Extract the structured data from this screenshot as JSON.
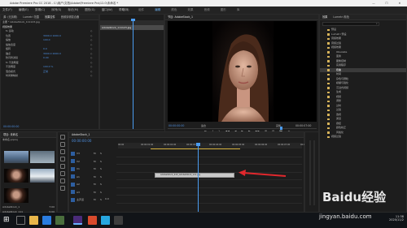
{
  "titlebar": {
    "title": "Adobe Premiere Pro CC 2018 - C:\\用户\\文档\\Adobe\\Premiere Pro\\12.0\\未命名 *",
    "minimize": "—",
    "maximize": "☐",
    "close": "✕"
  },
  "menubar": {
    "items": [
      "文件(F)",
      "编辑(E)",
      "剪辑(C)",
      "序列(S)",
      "标记(M)",
      "图形(G)",
      "窗口(W)",
      "帮助(H)"
    ]
  },
  "workspaces": {
    "items": [
      "学习",
      "组件",
      "编辑",
      "颜色",
      "效果",
      "音频",
      "图形",
      "库"
    ],
    "active": "编辑"
  },
  "effect_controls": {
    "tabs": [
      "源: (无剪辑)",
      "Lumetri 范围",
      "效果控件",
      "音频剪辑混合器"
    ],
    "active_tab": "效果控件",
    "clip_label": "主要 * AdobeStock_111123.jpg",
    "sequence_label": "AdobeStock_1 * AdobeStock_111123.jpg",
    "section": "视频效果",
    "rows": [
      {
        "name": "fx 运动",
        "value": ""
      },
      {
        "name": "位置",
        "value": "3000.0   1000.0"
      },
      {
        "name": "缩放",
        "value": "100.0"
      },
      {
        "name": "缩放宽度",
        "value": ""
      },
      {
        "name": "旋转",
        "value": "0.0"
      },
      {
        "name": "锚点",
        "value": "3000.0   2000.0"
      },
      {
        "name": "防闪烁滤镜",
        "value": "0.00"
      },
      {
        "name": "fx 不透明度",
        "value": ""
      },
      {
        "name": "不透明度",
        "value": "100.0 %"
      },
      {
        "name": "混合模式",
        "value": "正常"
      },
      {
        "name": "时间重映射",
        "value": ""
      }
    ],
    "timecode": "00:00:00:00"
  },
  "fx_timeline": {
    "clip_label": "AdobeStock_111123.jpg",
    "timecode": "00:00:05:00"
  },
  "program": {
    "tab": "节目: AdobeStock_1",
    "timecode_left": "00:00:00:00",
    "fit": "适合",
    "quality": "完整",
    "timecode_right": "00:00:07:00",
    "transport": [
      "⇤",
      "{",
      "}",
      "◀◀",
      "◀",
      "▶",
      "▶",
      "▶▶",
      "⊞",
      "⊟",
      "📷",
      "+"
    ]
  },
  "project_right": {
    "tabs": [
      "效果",
      "Lumetri 颜色"
    ],
    "search_placeholder": "",
    "items": [
      "预设",
      "Lumetri 预设",
      "音频效果",
      "音频过渡",
      "视频效果",
      "Obsolete",
      "变换",
      "图像控制",
      "实用程序",
      "扭曲",
      "时间",
      "杂色与颗粒",
      "模糊与锐化",
      "沉浸式视频",
      "生成",
      "视频",
      "调整",
      "过时",
      "过渡",
      "透视",
      "通道",
      "键控",
      "颜色校正",
      "风格化",
      "视频过渡"
    ],
    "highlight_index": 9
  },
  "project_panel": {
    "title": "项目: 未命名",
    "file": "未命名.prproj",
    "items": [
      {
        "name": "AdobeStock_1",
        "duration": "7:00"
      },
      {
        "name": "AdobeStock_111",
        "duration": "5:00"
      },
      {
        "name": "AdobeStock_222",
        "duration": "5:00"
      },
      {
        "name": "AdobeStock_333",
        "duration": "5:00"
      }
    ]
  },
  "timeline": {
    "tab": "AdobeStock_1",
    "timecode": "00:00:00:00",
    "ruler": [
      "00:00",
      "00:00:01:00",
      "00:00:02:00",
      "00:00:03:00",
      "00:00:04:00",
      "00:00:05:00",
      "00:00:06:00",
      "00:00:07:00",
      "00:00:08:00"
    ],
    "tracks": [
      "V3",
      "V2",
      "V1",
      "A1",
      "A2",
      "A3",
      "主声道"
    ],
    "clip_label": "AdobeStock_222_AdobeStock_xxx.jpg",
    "master_value": "0.0"
  },
  "taskbar": {
    "time": "11:38",
    "date": "2020/11/2"
  },
  "watermark": {
    "text": "Baidu经验",
    "url": "jingyan.baidu.com"
  },
  "colors": {
    "accent": "#2d8ceb",
    "playhead": "#4b9cf0",
    "arrow": "#e1282d",
    "clip": "#c9c9c9",
    "work_bar": "#d9b440",
    "folder": "#d8b45a"
  }
}
